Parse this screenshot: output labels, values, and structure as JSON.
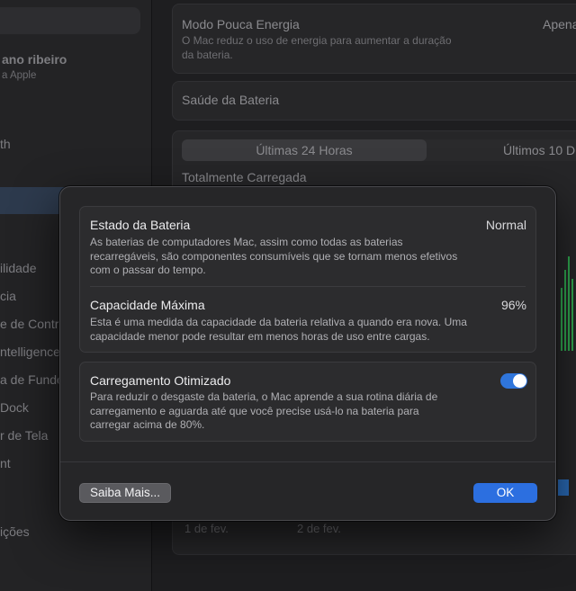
{
  "background": {
    "sidebar": {
      "user_name": "ano ribeiro",
      "user_subtitle": "a Apple",
      "items": [
        "th",
        "ilidade",
        "cia",
        "e de Contro",
        "ntelligence",
        "a de Fundo",
        "Dock",
        "r de Tela",
        "nt",
        "ições"
      ]
    },
    "low_power": {
      "title": "Modo Pouca Energia",
      "value": "Apena",
      "description_line1": "O Mac reduz o uso de energia para aumentar a duração",
      "description_line2": "da bateria."
    },
    "battery_health_label": "Saúde da Bateria",
    "tabs": [
      "Últimas 24 Horas",
      "Últimos 10 D"
    ],
    "fully_charged_label": "Totalmente Carregada",
    "dates": [
      "1 de fev.",
      "2 de fev."
    ]
  },
  "sheet": {
    "battery_state": {
      "title": "Estado da Bateria",
      "value": "Normal",
      "description": "As baterias de computadores Mac, assim como todas as baterias recarregáveis, são componentes consumíveis que se tornam menos efetivos com o passar do tempo."
    },
    "max_capacity": {
      "title": "Capacidade Máxima",
      "value": "96%",
      "description": "Esta é uma medida da capacidade da bateria relativa a quando era nova. Uma capacidade menor pode resultar em menos horas de uso entre cargas."
    },
    "optimized_charging": {
      "title": "Carregamento Otimizado",
      "enabled": true,
      "description": "Para reduzir o desgaste da bateria, o Mac aprende a sua rotina diária de carregamento e aguarda até que você precise usá-lo na bateria para carregar acima de 80%."
    },
    "learn_more_label": "Saiba Mais...",
    "ok_label": "OK"
  },
  "colors": {
    "accent": "#2c6fe0",
    "toggle_on": "#2f75db",
    "chart_green": "#2fa84f"
  }
}
